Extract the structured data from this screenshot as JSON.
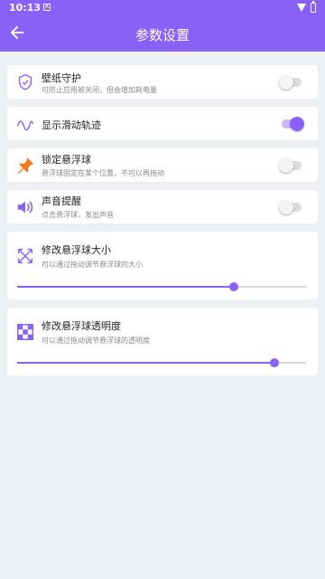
{
  "status_bar": {
    "time": "10:13",
    "notification_glyph": "A"
  },
  "app_bar": {
    "title": "参数设置",
    "back_icon": "arrow-left-icon"
  },
  "colors": {
    "accent": "#8a61f6",
    "background": "#edf0f3",
    "pin": "#f07a1a"
  },
  "settings": [
    {
      "title": "壁纸守护",
      "subtitle": "可防止应用被关闭，但会增加耗电量",
      "icon": "shield-check-icon",
      "enabled": false
    },
    {
      "title": "显示滑动轨迹",
      "subtitle": "",
      "icon": "wave-icon",
      "enabled": true
    },
    {
      "title": "锁定悬浮球",
      "subtitle": "悬浮球固定在某个位置，不可以再拖动",
      "icon": "pin-icon",
      "enabled": false
    },
    {
      "title": "声音提醒",
      "subtitle": "点击悬浮球，发出声音",
      "icon": "speaker-icon",
      "enabled": false
    }
  ],
  "sliders": [
    {
      "title": "修改悬浮球大小",
      "subtitle": "可以通过拖动调节悬浮球的大小",
      "icon": "resize-arrows-icon",
      "value": 0.75
    },
    {
      "title": "修改悬浮球透明度",
      "subtitle": "可以通过拖动调节悬浮球的透明度",
      "icon": "checkerboard-icon",
      "value": 0.89
    }
  ]
}
